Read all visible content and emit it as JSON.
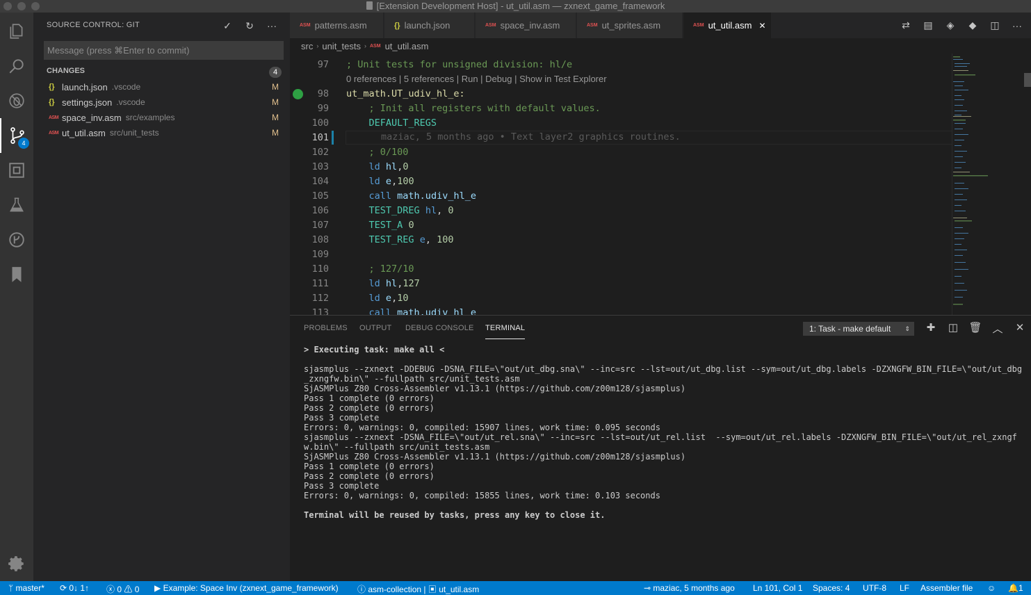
{
  "window": {
    "title": "[Extension Development Host] - ut_util.asm — zxnext_game_framework"
  },
  "activity": {
    "scm_badge": "4"
  },
  "sidebar": {
    "title": "SOURCE CONTROL: GIT",
    "commit_placeholder": "Message (press ⌘Enter to commit)",
    "changes_label": "CHANGES",
    "changes_count": "4",
    "files": [
      {
        "icon": "{}",
        "name": "launch.json",
        "dir": ".vscode",
        "status": "M"
      },
      {
        "icon": "{}",
        "name": "settings.json",
        "dir": ".vscode",
        "status": "M"
      },
      {
        "icon": "ASM",
        "name": "space_inv.asm",
        "dir": "src/examples",
        "status": "M"
      },
      {
        "icon": "ASM",
        "name": "ut_util.asm",
        "dir": "src/unit_tests",
        "status": "M"
      }
    ]
  },
  "tabs": [
    {
      "icon": "ASM",
      "label": "patterns.asm"
    },
    {
      "icon": "{}",
      "label": "launch.json"
    },
    {
      "icon": "ASM",
      "label": "space_inv.asm"
    },
    {
      "icon": "ASM",
      "label": "ut_sprites.asm"
    },
    {
      "icon": "ASM",
      "label": "ut_util.asm",
      "close": "✕"
    }
  ],
  "breadcrumb": [
    "src",
    "unit_tests",
    "ut_util.asm"
  ],
  "editor": {
    "codelens": "0 references | 5 references | Run | Debug | Show in Test Explorer",
    "blame": "maziac, 5 months ago • Text layer2 graphics routines.",
    "line_numbers": [
      "97",
      "98",
      "99",
      "100",
      "101",
      "102",
      "103",
      "104",
      "105",
      "106",
      "107",
      "108",
      "109",
      "110",
      "111",
      "112",
      "113"
    ]
  },
  "panel": {
    "tabs": [
      "PROBLEMS",
      "OUTPUT",
      "DEBUG CONSOLE",
      "TERMINAL"
    ],
    "terminal_select": "1: Task - make default",
    "lines": [
      "> Executing task: make all <",
      "",
      "sjasmplus --zxnext -DDEBUG -DSNA_FILE=\\\"out/ut_dbg.sna\\\" --inc=src --lst=out/ut_dbg.list --sym=out/ut_dbg.labels -DZXNGFW_BIN_FILE=\\\"out/ut_dbg_zxngfw.bin\\\" --fullpath src/unit_tests.asm",
      "SjASMPlus Z80 Cross-Assembler v1.13.1 (https://github.com/z00m128/sjasmplus)",
      "Pass 1 complete (0 errors)",
      "Pass 2 complete (0 errors)",
      "Pass 3 complete",
      "Errors: 0, warnings: 0, compiled: 15907 lines, work time: 0.095 seconds",
      "sjasmplus --zxnext -DSNA_FILE=\\\"out/ut_rel.sna\\\" --inc=src --lst=out/ut_rel.list  --sym=out/ut_rel.labels -DZXNGFW_BIN_FILE=\\\"out/ut_rel_zxngfw.bin\\\" --fullpath src/unit_tests.asm",
      "SjASMPlus Z80 Cross-Assembler v1.13.1 (https://github.com/z00m128/sjasmplus)",
      "Pass 1 complete (0 errors)",
      "Pass 2 complete (0 errors)",
      "Pass 3 complete",
      "Errors: 0, warnings: 0, compiled: 15855 lines, work time: 0.103 seconds",
      "",
      "Terminal will be reused by tasks, press any key to close it."
    ]
  },
  "status": {
    "branch": "master*",
    "sync": "0↓ 1↑",
    "errors": "0",
    "warnings": "0",
    "debug": "Example: Space Inv (zxnext_game_framework)",
    "lang_ext": "asm-collection |",
    "file": "ut_util.asm",
    "blame": "maziac, 5 months ago",
    "position": "Ln 101, Col 1",
    "spaces": "Spaces: 4",
    "encoding": "UTF-8",
    "eol": "LF",
    "language": "Assembler file",
    "notifications": "1"
  }
}
